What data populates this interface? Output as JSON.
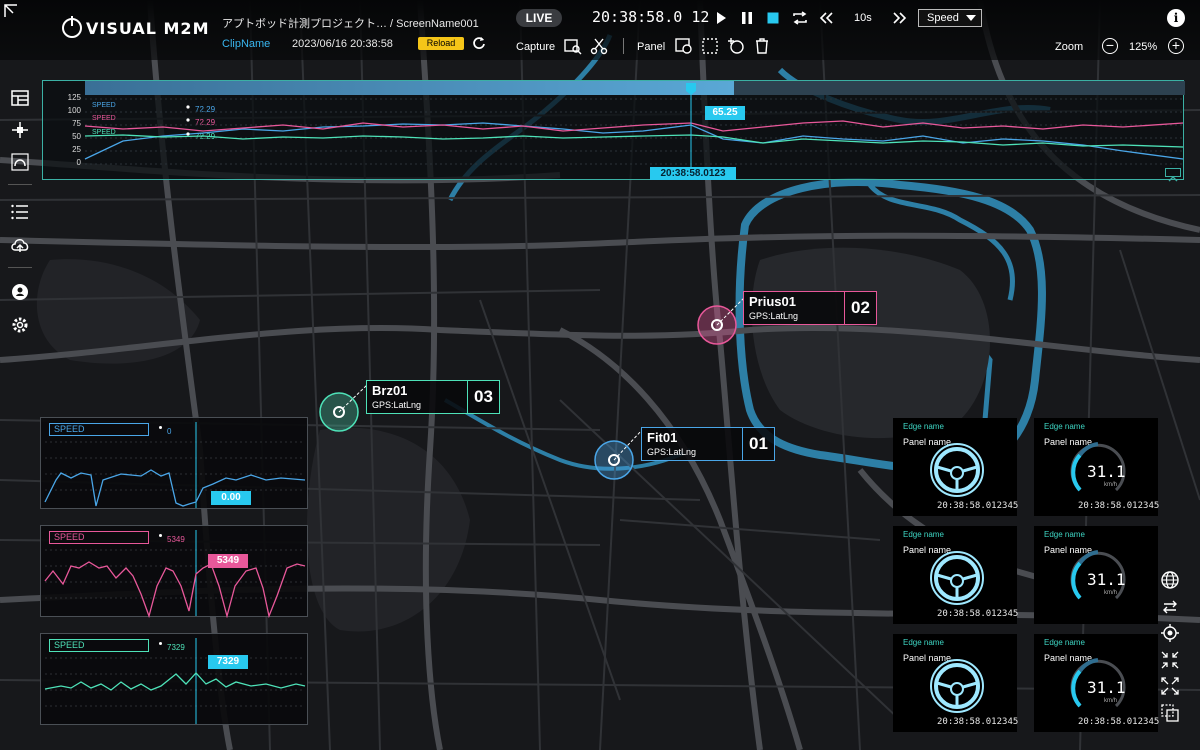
{
  "header": {
    "logo_text": "VISUAL M2M",
    "project_path": "アプトボッド計測プロジェクト… / ScreenName001",
    "clip_label": "ClipName",
    "clip_datetime": "2023/06/16 20:38:58",
    "reload_label": "Reload",
    "live_label": "LIVE",
    "clock": "20:38:58.0 12",
    "interval": "10s",
    "speed_select": "Speed",
    "capture_label": "Capture",
    "panel_label": "Panel",
    "zoom_label": "Zoom",
    "zoom_value": "125%"
  },
  "timeline": {
    "progress": 0.59,
    "yticks": [
      "125",
      "100",
      "75",
      "50",
      "25",
      "0"
    ],
    "series": [
      {
        "name": "SPEED",
        "value": "72.29",
        "color": "#4aa6e8"
      },
      {
        "name": "SPEED",
        "value": "72.29",
        "color": "#e8589a"
      },
      {
        "name": "SPEED",
        "value": "72.29",
        "color": "#4ee2b8"
      }
    ],
    "cursor_value": "65.25",
    "cursor_time": "20:38:58.0123"
  },
  "vehicles": [
    {
      "name": "Prius01",
      "gps": "GPS:LatLng",
      "number": "02",
      "color": "#e8589a"
    },
    {
      "name": "Brz01",
      "gps": "GPS:LatLng",
      "number": "03",
      "color": "#4ee2b8"
    },
    {
      "name": "Fit01",
      "gps": "GPS:LatLng",
      "number": "01",
      "color": "#4aa6e8"
    }
  ],
  "graphs": [
    {
      "title": "SPEED",
      "small_value": "0",
      "tag": "0.00",
      "color": "#4aa6e8",
      "tag_bg": "#28c9ef"
    },
    {
      "title": "SPEED",
      "small_value": "5349",
      "tag": "5349",
      "color": "#e8589a",
      "tag_bg": "#e8589a"
    },
    {
      "title": "SPEED",
      "small_value": "7329",
      "tag": "7329",
      "color": "#4ee2b8",
      "tag_bg": "#28c9ef"
    }
  ],
  "edge_panels": [
    {
      "edge": "Edge name",
      "panel": "Panel name",
      "time": "20:38:58.012345",
      "kind": "steering"
    },
    {
      "edge": "Edge name",
      "panel": "Panel name",
      "time": "20:38:58.012345",
      "kind": "speedometer",
      "speed": "31.1",
      "unit": "km/h"
    },
    {
      "edge": "Edge name",
      "panel": "Panel name",
      "time": "20:38:58.012345",
      "kind": "steering"
    },
    {
      "edge": "Edge name",
      "panel": "Panel name",
      "time": "",
      "kind": "speedometer",
      "speed": "31.1",
      "unit": "km/h"
    },
    {
      "edge": "Edge name",
      "panel": "Panel name",
      "time": "20:38:58.012345",
      "kind": "steering"
    },
    {
      "edge": "Edge name",
      "panel": "Panel name",
      "time": "20:38:58.012345",
      "kind": "speedometer",
      "speed": "31.1",
      "unit": "km/h"
    }
  ],
  "icons": {
    "corner": "expand-icon",
    "play": "play-icon",
    "pause": "pause-icon",
    "stop": "stop-icon",
    "loop": "loop-icon",
    "rewind": "rewind-icon",
    "forward": "fast-forward-icon",
    "sidebar": [
      "layout-icon",
      "crosshair-move-icon",
      "curve-icon",
      "list-icon",
      "cloud-upload-icon",
      "user-icon",
      "settings-icon"
    ],
    "rightbar": [
      "globe-icon",
      "swap-icon",
      "locate-icon",
      "shrink-icon",
      "expand-arrows-icon",
      "layers-icon"
    ]
  },
  "colors": {
    "accent": "#28c9ef",
    "timeline_border": "#3bb0a4",
    "water": "#2d7fa6"
  }
}
